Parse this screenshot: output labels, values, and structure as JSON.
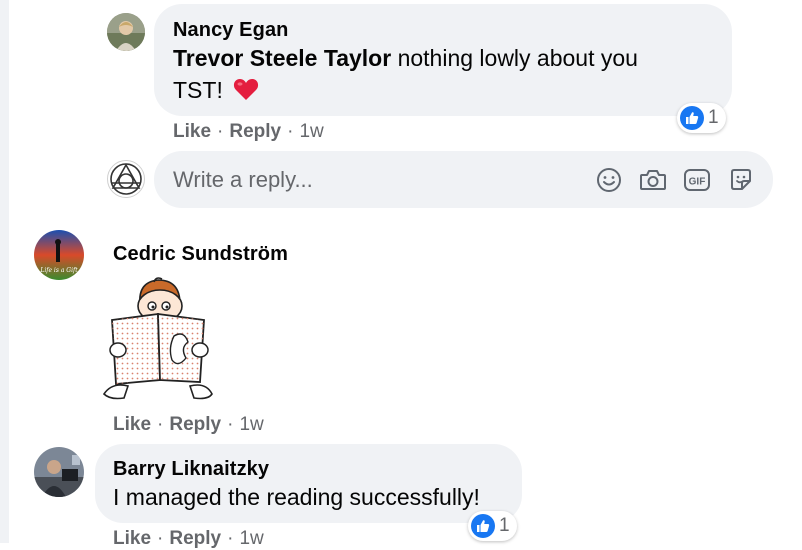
{
  "comments": [
    {
      "author": "Nancy Egan",
      "mention": "Trevor Steele Taylor",
      "text": " nothing lowly about you TST!",
      "emoji": "heart",
      "reactions": {
        "type": "like",
        "count": "1"
      },
      "actions": {
        "like": "Like",
        "reply": "Reply",
        "time": "1w"
      }
    },
    {
      "author": "Cedric Sundström",
      "sticker": "reading-book-sticker",
      "actions": {
        "like": "Like",
        "reply": "Reply",
        "time": "1w"
      }
    },
    {
      "author": "Barry Liknaitzky",
      "text": "I managed the reading successfully!",
      "reactions": {
        "type": "like",
        "count": "1"
      },
      "actions": {
        "like": "Like",
        "reply": "Reply",
        "time": "1w"
      }
    }
  ],
  "reply_box": {
    "placeholder": "Write a reply...",
    "tools": [
      "emoji-icon",
      "camera-icon",
      "gif-icon",
      "sticker-icon"
    ]
  },
  "separator": "·",
  "colors": {
    "bubble": "#f0f2f5",
    "secondary_text": "#65676b",
    "like_blue": "#1877f2",
    "heart_red": "#e41e3f"
  }
}
